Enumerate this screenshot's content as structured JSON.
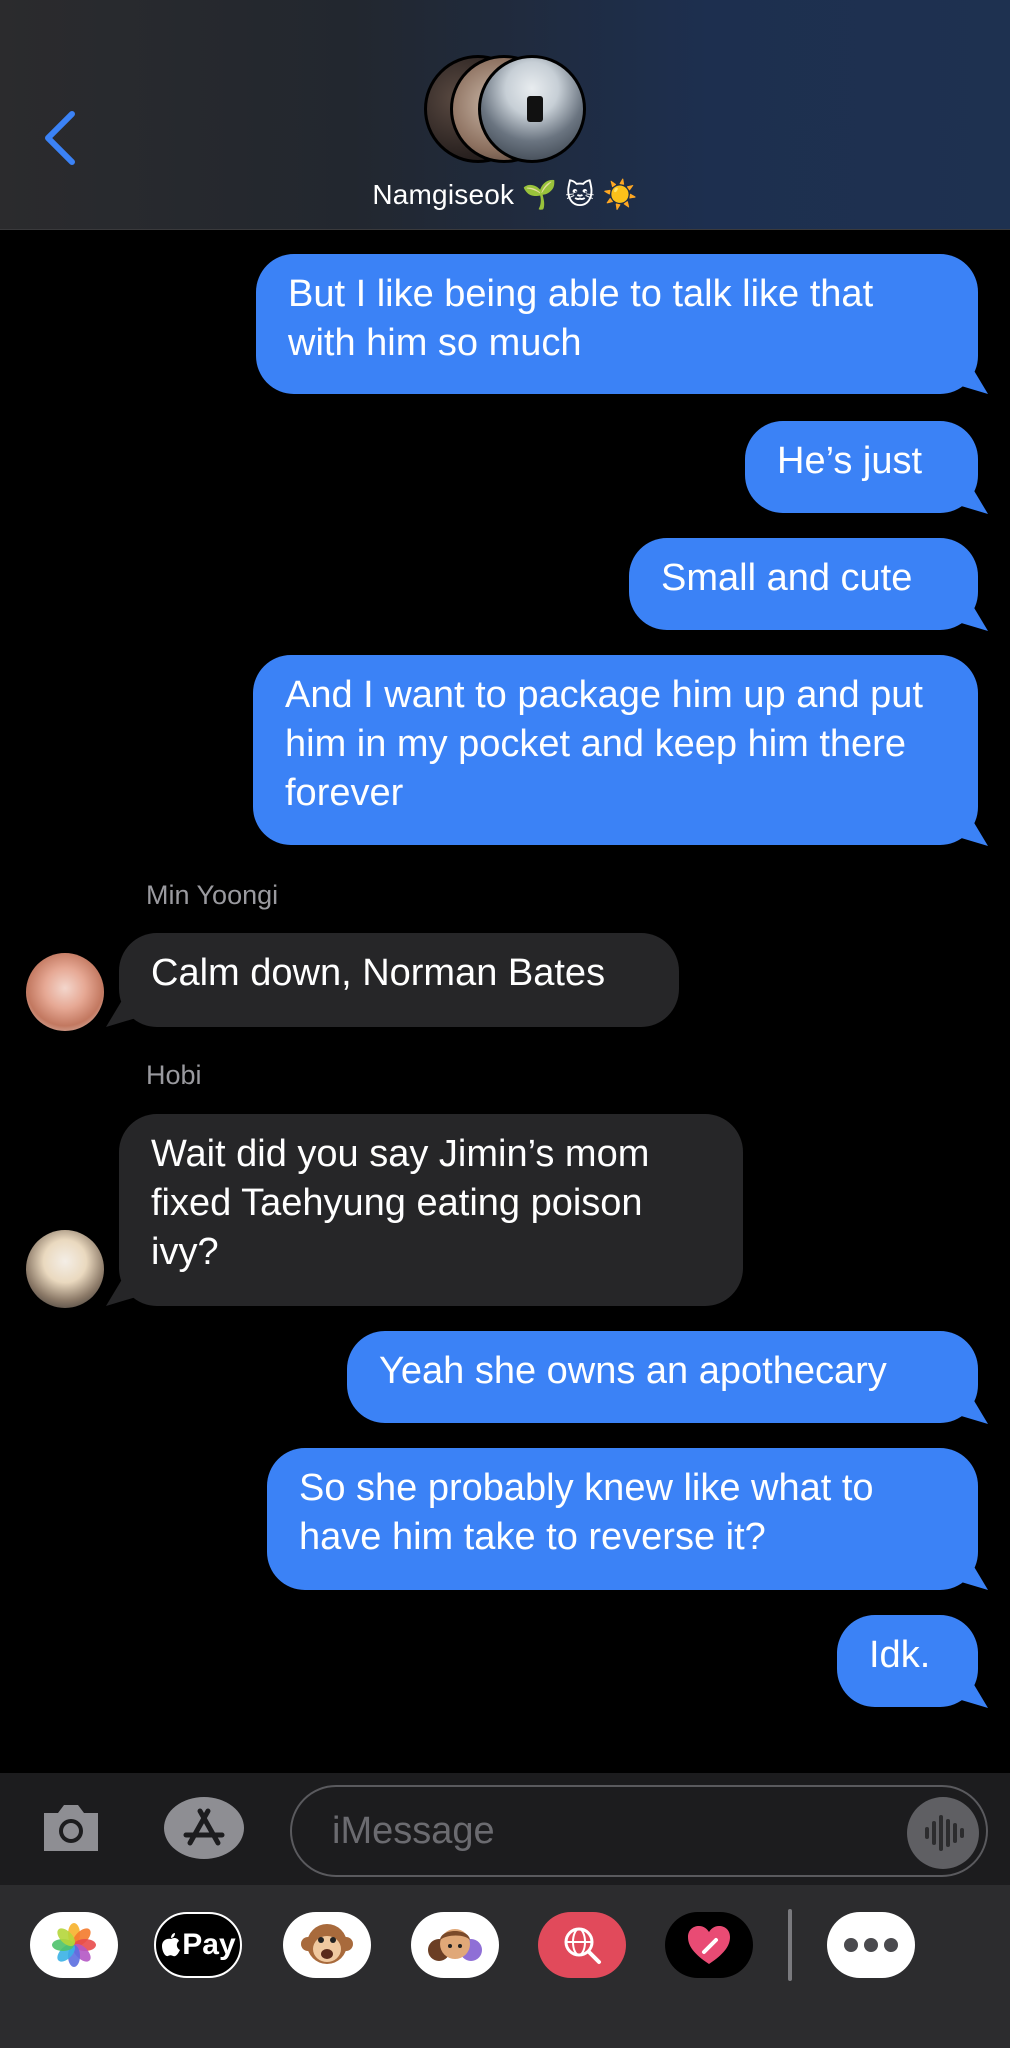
{
  "header": {
    "title": "Namgiseok 🌱 🐱 ☀️",
    "back_label": "Back"
  },
  "messages": [
    {
      "direction": "sent",
      "text": "But I like being able to talk like that with him so much"
    },
    {
      "direction": "sent",
      "text": "He’s just"
    },
    {
      "direction": "sent",
      "text": "Small and cute"
    },
    {
      "direction": "sent",
      "text": "And I want to package him up and put him in my pocket and keep him there forever"
    },
    {
      "direction": "received",
      "sender": "Min Yoongi",
      "text": "Calm down, Norman Bates"
    },
    {
      "direction": "received",
      "sender": "Hobi",
      "text": "Wait did you say Jimin’s mom fixed Taehyung eating poison ivy?"
    },
    {
      "direction": "sent",
      "text": "Yeah she owns an apothecary"
    },
    {
      "direction": "sent",
      "text": "So she probably knew like what to have him take to reverse it?"
    },
    {
      "direction": "sent",
      "text": "Idk."
    }
  ],
  "input": {
    "placeholder": "iMessage",
    "value": ""
  },
  "app_drawer": {
    "pay_label": "Pay",
    "apps": [
      "photos-icon",
      "apple-pay-icon",
      "animoji-icon",
      "memoji-icon",
      "web-search-icon",
      "digital-touch-icon",
      "more-icon"
    ]
  },
  "colors": {
    "sent_bubble": "#3b82f6",
    "received_bubble": "#262628",
    "accent": "#3b82f6",
    "background": "#000000"
  }
}
